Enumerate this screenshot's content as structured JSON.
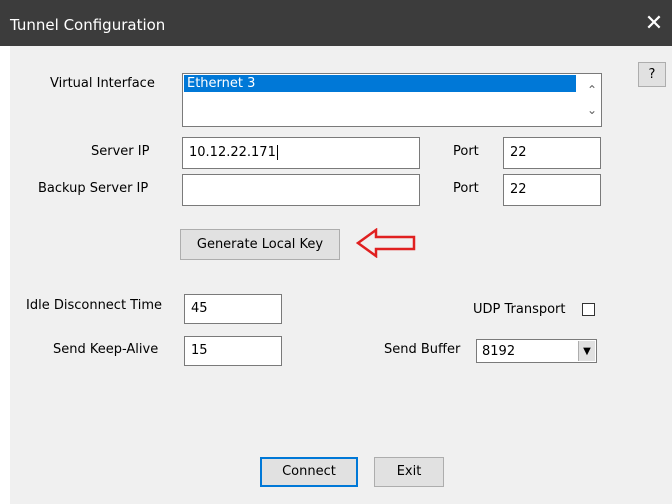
{
  "window": {
    "title": "Tunnel Configuration",
    "close_glyph": "✕"
  },
  "help_button": {
    "label": "?"
  },
  "virtual_interface": {
    "label": "Virtual Interface",
    "selected_item": "Ethernet 3",
    "scroll_up": "^",
    "scroll_down": "v"
  },
  "server_ip": {
    "label": "Server IP",
    "value": "10.12.22.171",
    "port_label": "Port",
    "port_value": "22"
  },
  "backup_server_ip": {
    "label": "Backup Server IP",
    "value": "",
    "port_label": "Port",
    "port_value": "22"
  },
  "generate_key_button": {
    "label": "Generate Local Key"
  },
  "annotation": {
    "arrow_color": "#e02020"
  },
  "idle_disconnect": {
    "label": "Idle Disconnect Time",
    "value": "45"
  },
  "send_keepalive": {
    "label": "Send Keep-Alive",
    "value": "15"
  },
  "udp_transport": {
    "label": "UDP Transport",
    "checked": false
  },
  "send_buffer": {
    "label": "Send Buffer",
    "value": "8192"
  },
  "buttons": {
    "connect": "Connect",
    "exit": "Exit"
  },
  "colors": {
    "titlebar": "#3c3c3c",
    "dialog": "#f0f0f0",
    "selection": "#0078d7"
  }
}
